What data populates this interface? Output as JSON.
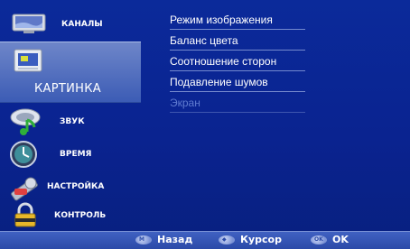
{
  "menu": {
    "items": [
      {
        "label": "КАНАЛЫ",
        "icon": "monitor-icon"
      },
      {
        "label": "КАРТИНКА",
        "icon": "picture-icon",
        "active": true
      },
      {
        "label": "ЗВУК",
        "icon": "sound-icon"
      },
      {
        "label": "ВРЕМЯ",
        "icon": "clock-icon"
      },
      {
        "label": "НАСТРОЙКА",
        "icon": "settings-icon"
      },
      {
        "label": "КОНТРОЛЬ",
        "icon": "lock-icon"
      }
    ]
  },
  "submenu": {
    "items": [
      {
        "label": "Режим изображения"
      },
      {
        "label": "Баланс цвета"
      },
      {
        "label": "Соотношение сторон"
      },
      {
        "label": "Подавление шумов"
      },
      {
        "label": "Экран",
        "disabled": true
      }
    ]
  },
  "bottombar": {
    "back_label": "Назад",
    "cursor_label": "Курсор",
    "ok_label": "OK"
  },
  "colors": {
    "background": "#0a2390",
    "active_item": "#4f6ec0",
    "disabled_text": "#5f7bd0"
  }
}
